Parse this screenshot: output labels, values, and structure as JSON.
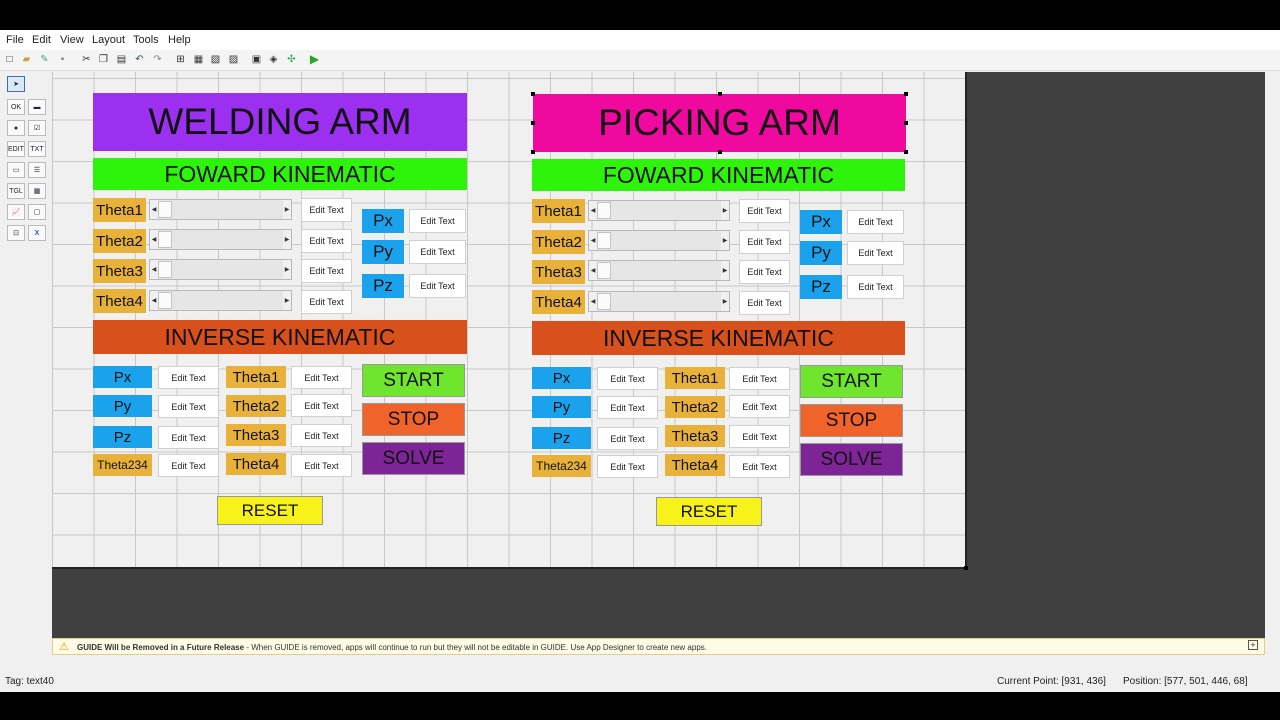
{
  "menu": [
    "File",
    "Edit",
    "View",
    "Layout",
    "Tools",
    "Help"
  ],
  "toolbar_icons": [
    "new-icon",
    "open-icon",
    "edit-icon",
    "save-icon",
    "cut-icon",
    "copy-icon",
    "paste-icon",
    "undo-icon",
    "redo-icon",
    "align-icon",
    "menu-editor-icon",
    "tab-order-icon",
    "toolbar-editor-icon",
    "editor-icon",
    "property-inspector-icon",
    "object-browser-icon",
    "run-icon"
  ],
  "palette": [
    "select",
    "PB",
    "SLD",
    "RB",
    "CB",
    "EDIT",
    "TXT",
    "POP",
    "LB",
    "TGL",
    "TBL",
    "AX",
    "PNL",
    "BG",
    "X"
  ],
  "welding": {
    "title": "WELDING ARM",
    "fk_title": "FOWARD KINEMATIC",
    "thetas": [
      "Theta1",
      "Theta2",
      "Theta3",
      "Theta4"
    ],
    "edit": "Edit Text",
    "pos": [
      "Px",
      "Py",
      "Pz"
    ],
    "ik_title": "INVERSE KINEMATIC",
    "ik_left": [
      "Px",
      "Py",
      "Pz",
      "Theta234"
    ],
    "ik_mid": [
      "Theta1",
      "Theta2",
      "Theta3",
      "Theta4"
    ],
    "start": "START",
    "stop": "STOP",
    "solve": "SOLVE",
    "reset": "RESET"
  },
  "picking": {
    "title": "PICKING ARM",
    "fk_title": "FOWARD KINEMATIC",
    "thetas": [
      "Theta1",
      "Theta2",
      "Theta3",
      "Theta4"
    ],
    "edit": "Edit Text",
    "pos": [
      "Px",
      "Py",
      "Pz"
    ],
    "ik_title": "INVERSE KINEMATIC",
    "ik_left": [
      "Px",
      "Py",
      "Pz",
      "Theta234"
    ],
    "ik_mid": [
      "Theta1",
      "Theta2",
      "Theta3",
      "Theta4"
    ],
    "start": "START",
    "stop": "STOP",
    "solve": "SOLVE",
    "reset": "RESET"
  },
  "warning": {
    "bold": "GUIDE Will be Removed in a Future Release",
    "text": " - When GUIDE is removed, apps will continue to run but they will not be editable in GUIDE.  Use App Designer to create new apps."
  },
  "status": {
    "tag": "Tag: text40",
    "current_point": "Current Point:  [931, 436]",
    "position": "Position: [577, 501, 446, 68]"
  },
  "colors": {
    "welding_title": "#9b30f0",
    "picking_title": "#f0099e",
    "fk_band": "#2ef40c",
    "ik_band": "#d8501c",
    "orange_label": "#e8b23a",
    "blue_label": "#1aa3ec",
    "start": "#6fe52e",
    "stop": "#f0632a",
    "solve": "#7d2597",
    "reset": "#f7f21a"
  }
}
